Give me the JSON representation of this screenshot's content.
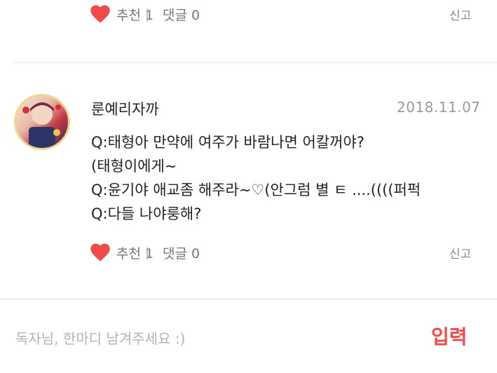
{
  "top_actions": {
    "recommend": "추천 1",
    "separator": "|",
    "comment": "댓글 0",
    "report": "신고"
  },
  "comment_item": {
    "author": "룬예리자까",
    "date": "2018.11.07",
    "lines": [
      "Q:태형아 만약에 여주가 바람나면 어칼꺼야?",
      "(태형이에게~",
      "Q:윤기야 애교좀 해주라~♡(안그럼 별 ㅌ ....((((퍼퍽",
      "Q:다들 나야룽해?"
    ],
    "actions": {
      "recommend": "추천 1",
      "separator": "|",
      "comment": "댓글 0",
      "report": "신고"
    }
  },
  "comment_input": {
    "placeholder": "독자님, 한마디 남겨주세요 :)",
    "submit_label": "입력"
  },
  "colors": {
    "heart": "#ef4b4b",
    "submit": "#ef4b4b",
    "date": "#9a9a9a"
  }
}
